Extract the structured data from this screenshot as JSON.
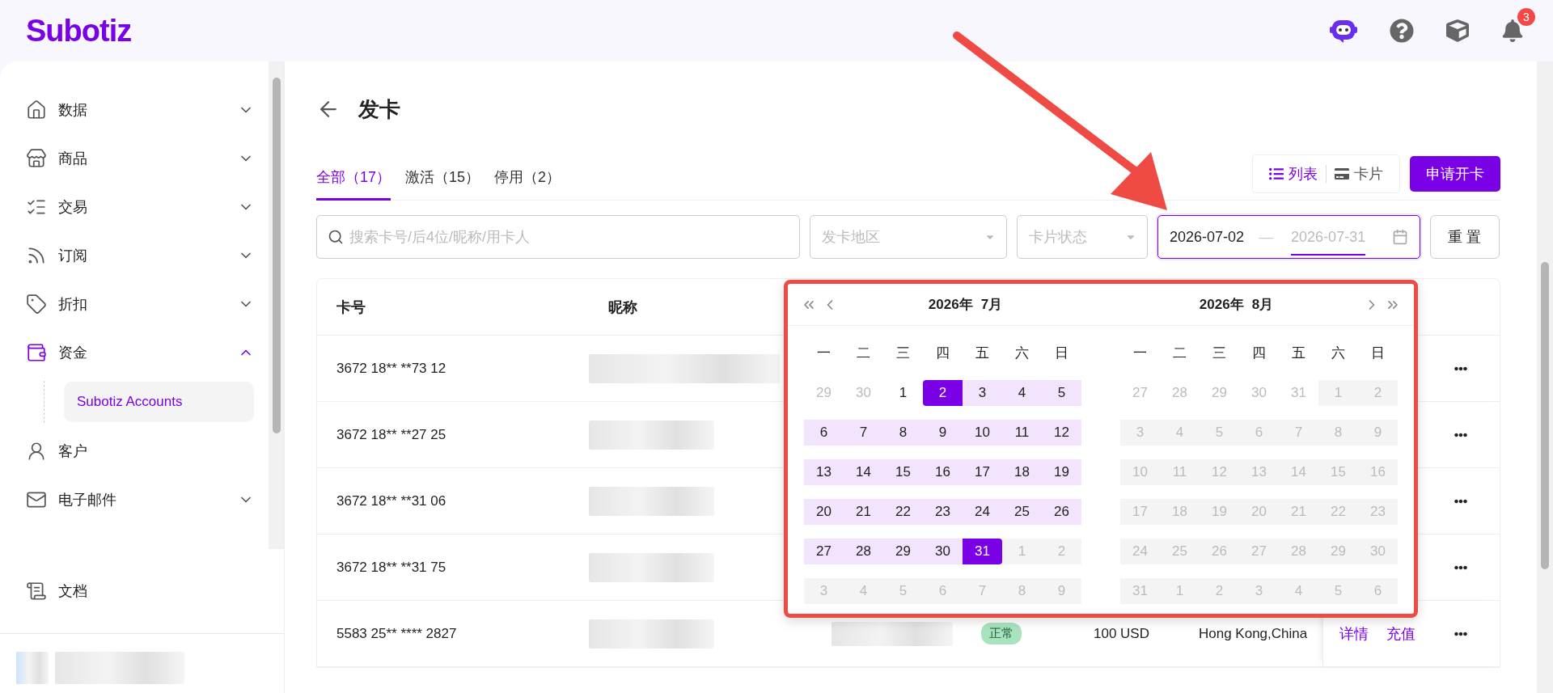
{
  "brand": "Subotiz",
  "topbar": {
    "notification_count": "3"
  },
  "sidebar": {
    "items": [
      {
        "label": "数据",
        "expanded": false,
        "selected": false
      },
      {
        "label": "商品",
        "expanded": false,
        "selected": false
      },
      {
        "label": "交易",
        "expanded": false,
        "selected": false
      },
      {
        "label": "订阅",
        "expanded": false,
        "selected": false
      },
      {
        "label": "折扣",
        "expanded": false,
        "selected": false
      },
      {
        "label": "资金",
        "expanded": true,
        "selected": true,
        "children": [
          {
            "label": "Subotiz Accounts",
            "selected": true
          }
        ]
      },
      {
        "label": "客户",
        "selected": false
      },
      {
        "label": "电子邮件",
        "expanded": false,
        "selected": false
      }
    ],
    "footer_item": {
      "label": "文档"
    }
  },
  "page": {
    "title": "发卡"
  },
  "tabs": [
    {
      "label": "全部（17）",
      "selected": true
    },
    {
      "label": "激活（15）",
      "selected": false
    },
    {
      "label": "停用（2）",
      "selected": false
    }
  ],
  "view_toggle": [
    {
      "label": "列表",
      "selected": true
    },
    {
      "label": "卡片",
      "selected": false
    }
  ],
  "apply_button": "申请开卡",
  "filters": {
    "search_placeholder": "搜索卡号/后4位/昵称/用卡人",
    "region_placeholder": "发卡地区",
    "status_placeholder": "卡片状态",
    "date_range": [
      {
        "value": "2026-07-02",
        "active": false
      },
      {
        "value": "2026-07-31",
        "active": true
      }
    ],
    "date_separator": "—",
    "reset": "重 置"
  },
  "table": {
    "columns": [
      "卡号",
      "昵称"
    ],
    "rows": [
      {
        "card_number": "3672 18** **73 12"
      },
      {
        "card_number": "3672 18** **27 25"
      },
      {
        "card_number": "3672 18** **31 06"
      },
      {
        "card_number": "3672 18** **31 75"
      },
      {
        "card_number": "5583 25** **** 2827",
        "status": "正常",
        "amount": "100 USD",
        "region": "Hong Kong,China",
        "actions": [
          "详情",
          "充值"
        ]
      }
    ]
  },
  "calendar": {
    "months": [
      {
        "year": "2026年",
        "month": "7月",
        "weekdays": [
          "一",
          "二",
          "三",
          "四",
          "五",
          "六",
          "日"
        ],
        "weeks": [
          [
            {
              "d": "29",
              "kind": "outside"
            },
            {
              "d": "30",
              "kind": "outside"
            },
            {
              "d": "1",
              "kind": "normal"
            },
            {
              "d": "2",
              "kind": "start"
            },
            {
              "d": "3",
              "kind": "range"
            },
            {
              "d": "4",
              "kind": "range"
            },
            {
              "d": "5",
              "kind": "range"
            }
          ],
          [
            {
              "d": "6",
              "kind": "range"
            },
            {
              "d": "7",
              "kind": "range"
            },
            {
              "d": "8",
              "kind": "range"
            },
            {
              "d": "9",
              "kind": "range"
            },
            {
              "d": "10",
              "kind": "range"
            },
            {
              "d": "11",
              "kind": "range"
            },
            {
              "d": "12",
              "kind": "range"
            }
          ],
          [
            {
              "d": "13",
              "kind": "range"
            },
            {
              "d": "14",
              "kind": "range"
            },
            {
              "d": "15",
              "kind": "range"
            },
            {
              "d": "16",
              "kind": "range"
            },
            {
              "d": "17",
              "kind": "range"
            },
            {
              "d": "18",
              "kind": "range"
            },
            {
              "d": "19",
              "kind": "range"
            }
          ],
          [
            {
              "d": "20",
              "kind": "range"
            },
            {
              "d": "21",
              "kind": "range"
            },
            {
              "d": "22",
              "kind": "range"
            },
            {
              "d": "23",
              "kind": "range"
            },
            {
              "d": "24",
              "kind": "range"
            },
            {
              "d": "25",
              "kind": "range"
            },
            {
              "d": "26",
              "kind": "range"
            }
          ],
          [
            {
              "d": "27",
              "kind": "range"
            },
            {
              "d": "28",
              "kind": "range"
            },
            {
              "d": "29",
              "kind": "range"
            },
            {
              "d": "30",
              "kind": "range"
            },
            {
              "d": "31",
              "kind": "end"
            },
            {
              "d": "1",
              "kind": "disabled"
            },
            {
              "d": "2",
              "kind": "disabled"
            }
          ],
          [
            {
              "d": "3",
              "kind": "disabled"
            },
            {
              "d": "4",
              "kind": "disabled"
            },
            {
              "d": "5",
              "kind": "disabled"
            },
            {
              "d": "6",
              "kind": "disabled"
            },
            {
              "d": "7",
              "kind": "disabled"
            },
            {
              "d": "8",
              "kind": "disabled"
            },
            {
              "d": "9",
              "kind": "disabled"
            }
          ]
        ]
      },
      {
        "year": "2026年",
        "month": "8月",
        "weekdays": [
          "一",
          "二",
          "三",
          "四",
          "五",
          "六",
          "日"
        ],
        "weeks": [
          [
            {
              "d": "27",
              "kind": "outside"
            },
            {
              "d": "28",
              "kind": "outside"
            },
            {
              "d": "29",
              "kind": "outside"
            },
            {
              "d": "30",
              "kind": "outside"
            },
            {
              "d": "31",
              "kind": "outside"
            },
            {
              "d": "1",
              "kind": "disabled"
            },
            {
              "d": "2",
              "kind": "disabled"
            }
          ],
          [
            {
              "d": "3",
              "kind": "disabled"
            },
            {
              "d": "4",
              "kind": "disabled"
            },
            {
              "d": "5",
              "kind": "disabled"
            },
            {
              "d": "6",
              "kind": "disabled"
            },
            {
              "d": "7",
              "kind": "disabled"
            },
            {
              "d": "8",
              "kind": "disabled"
            },
            {
              "d": "9",
              "kind": "disabled"
            }
          ],
          [
            {
              "d": "10",
              "kind": "disabled"
            },
            {
              "d": "11",
              "kind": "disabled"
            },
            {
              "d": "12",
              "kind": "disabled"
            },
            {
              "d": "13",
              "kind": "disabled"
            },
            {
              "d": "14",
              "kind": "disabled"
            },
            {
              "d": "15",
              "kind": "disabled"
            },
            {
              "d": "16",
              "kind": "disabled"
            }
          ],
          [
            {
              "d": "17",
              "kind": "disabled"
            },
            {
              "d": "18",
              "kind": "disabled"
            },
            {
              "d": "19",
              "kind": "disabled"
            },
            {
              "d": "20",
              "kind": "disabled"
            },
            {
              "d": "21",
              "kind": "disabled"
            },
            {
              "d": "22",
              "kind": "disabled"
            },
            {
              "d": "23",
              "kind": "disabled"
            }
          ],
          [
            {
              "d": "24",
              "kind": "disabled"
            },
            {
              "d": "25",
              "kind": "disabled"
            },
            {
              "d": "26",
              "kind": "disabled"
            },
            {
              "d": "27",
              "kind": "disabled"
            },
            {
              "d": "28",
              "kind": "disabled"
            },
            {
              "d": "29",
              "kind": "disabled"
            },
            {
              "d": "30",
              "kind": "disabled"
            }
          ],
          [
            {
              "d": "31",
              "kind": "disabled"
            },
            {
              "d": "1",
              "kind": "disabled"
            },
            {
              "d": "2",
              "kind": "disabled"
            },
            {
              "d": "3",
              "kind": "disabled"
            },
            {
              "d": "4",
              "kind": "disabled"
            },
            {
              "d": "5",
              "kind": "disabled"
            },
            {
              "d": "6",
              "kind": "disabled"
            }
          ]
        ]
      }
    ]
  }
}
